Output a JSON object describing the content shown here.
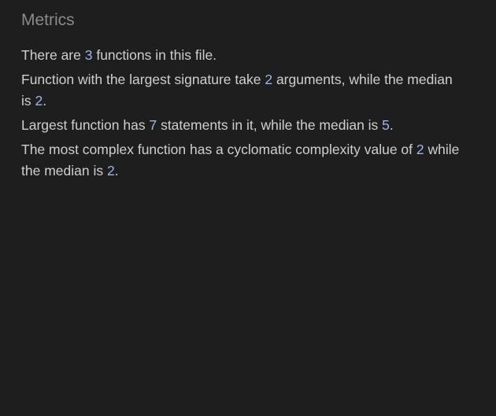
{
  "metrics": {
    "title": "Metrics",
    "line1": {
      "before": "There are ",
      "count": "3",
      "after": " functions in this file."
    },
    "line2": {
      "before": "Function with the largest signature take ",
      "largest": "2",
      "middle": " arguments, while the median is ",
      "median": "2",
      "after": "."
    },
    "line3": {
      "before": "Largest function has ",
      "largest": "7",
      "middle": " statements in it, while the median is ",
      "median": "5",
      "after": "."
    },
    "line4": {
      "before": "The most complex function has a cyclomatic complexity value of ",
      "largest": "2",
      "middle": " while the median is ",
      "median": "2",
      "after": "."
    }
  },
  "colors": {
    "background": "#1e1e1e",
    "text": "#cfcfcf",
    "title": "#8a8a8a",
    "number": "#9cb4e8"
  }
}
